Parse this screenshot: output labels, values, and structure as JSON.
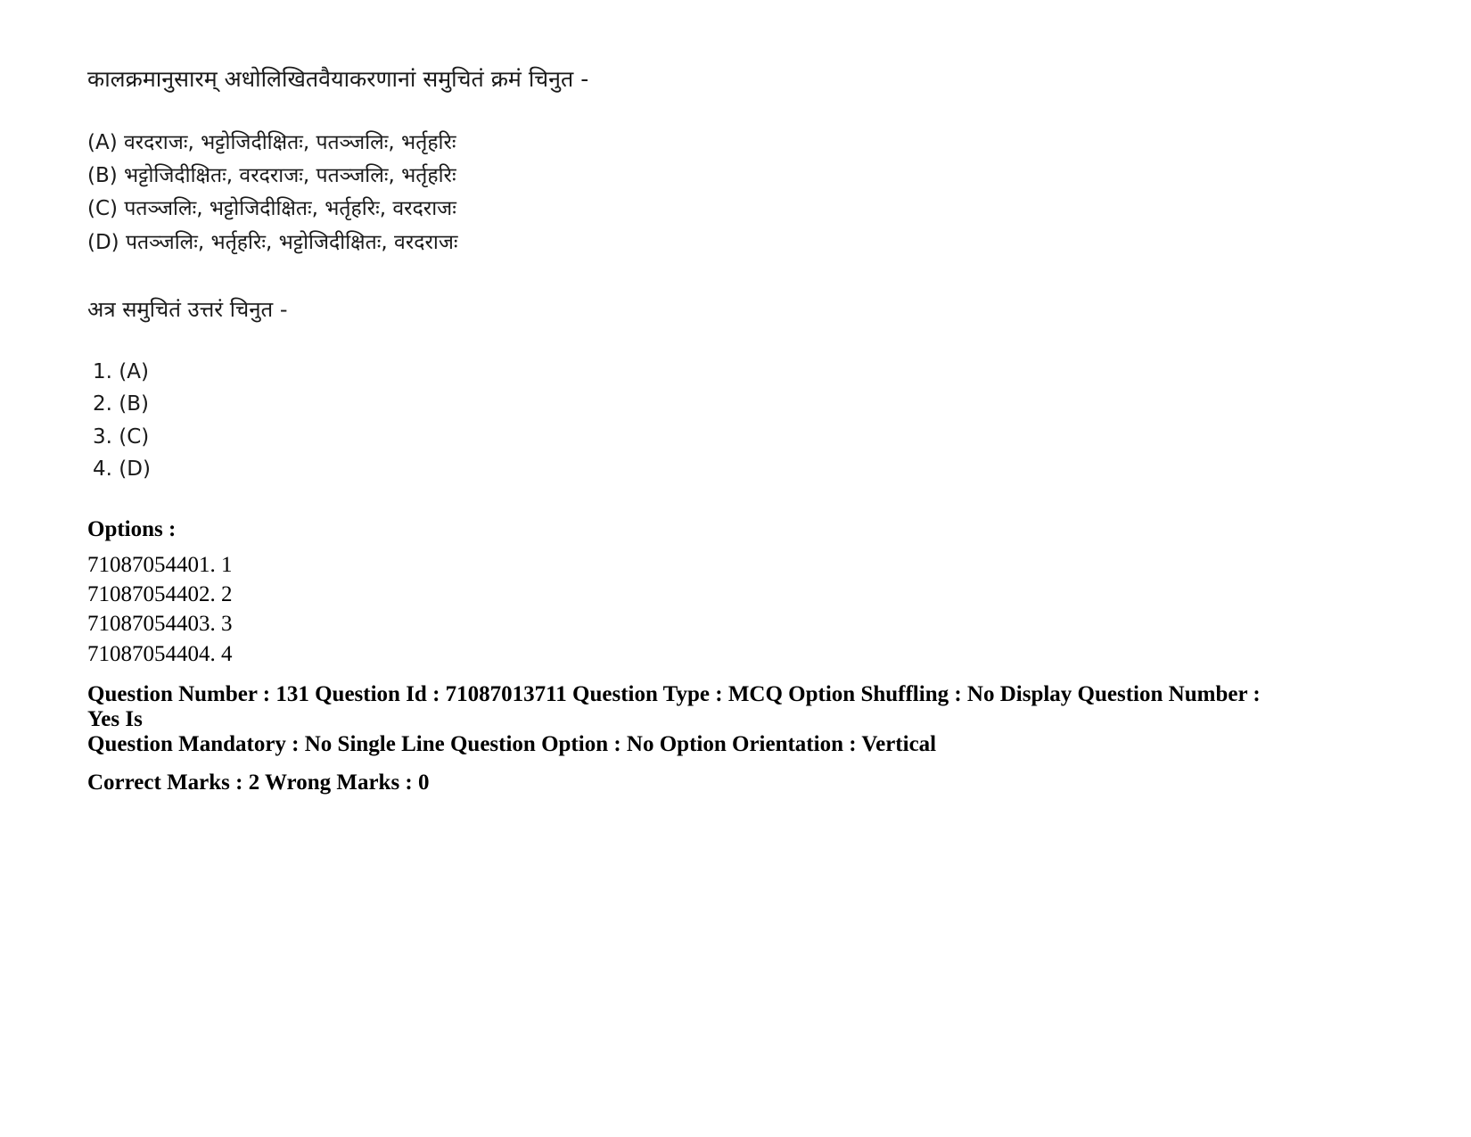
{
  "question": {
    "stem": "कालक्रमानुसारम् अधोलिखितवैयाकरणानां समुचितं क्रमं चिनुत -",
    "choices": [
      "(A) वरदराजः, भट्टोजिदीक्षितः, पतञ्जलिः, भर्तृहरिः",
      "(B) भट्टोजिदीक्षितः, वरदराजः, पतञ्जलिः, भर्तृहरिः",
      "(C) पतञ्जलिः, भट्टोजिदीक्षितः, भर्तृहरिः, वरदराजः",
      "(D)  पतञ्जलिः, भर्तृहरिः, भट्टोजिदीक्षितः, वरदराजः"
    ],
    "sub_prompt": "अत्र समुचितं उत्तरं चिनुत -",
    "answers": [
      "1. (A)",
      "2. (B)",
      "3. (C)",
      "4. (D)"
    ]
  },
  "options": {
    "heading": "Options :",
    "items": [
      "71087054401. 1",
      "71087054402. 2",
      "71087054403. 3",
      "71087054404. 4"
    ]
  },
  "metadata": {
    "line1": "Question Number : 131 Question Id : 71087013711 Question Type : MCQ Option Shuffling : No Display Question Number : Yes Is",
    "line2": "Question Mandatory : No Single Line Question Option : No Option Orientation : Vertical",
    "line3": "Correct Marks : 2 Wrong Marks : 0"
  }
}
